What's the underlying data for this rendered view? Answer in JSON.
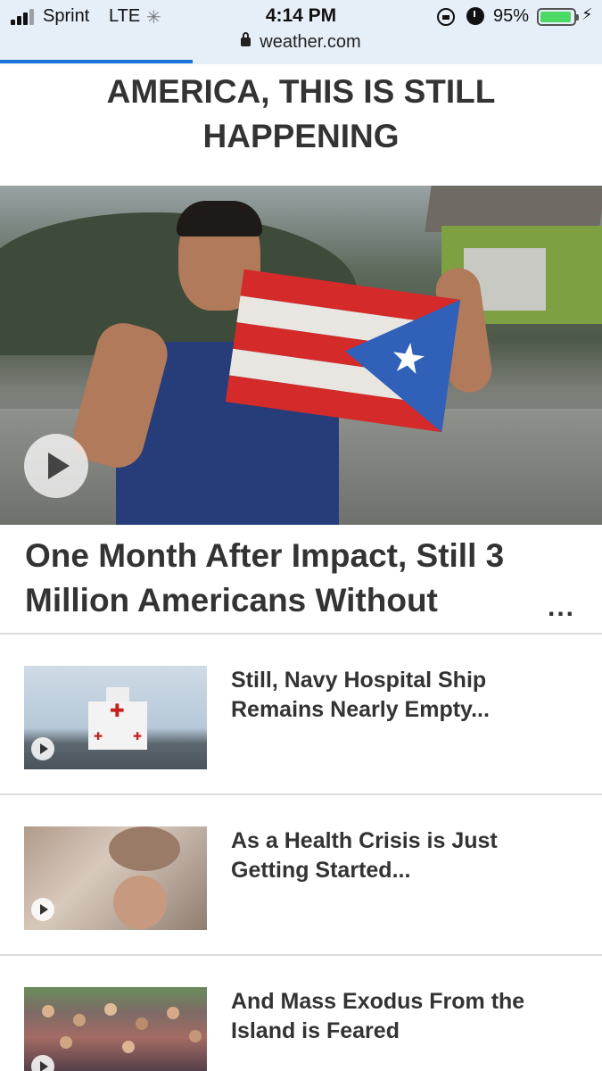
{
  "status_bar": {
    "carrier": "Sprint",
    "network": "LTE",
    "time": "4:14 PM",
    "battery_percent": "95%",
    "battery_level": 0.95
  },
  "browser": {
    "url": "weather.com",
    "load_progress": 0.32
  },
  "banner": {
    "headline": "AMERICA, THIS IS STILL HAPPENING"
  },
  "hero": {
    "image": "man-holding-damaged-puerto-rico-flag",
    "has_video": true
  },
  "main_article": {
    "title": "One Month After Impact, Still 3 Million Americans Without",
    "more": "..."
  },
  "articles": [
    {
      "title": "Still, Navy Hospital Ship Remains Nearly Empty...",
      "thumb": "hospital-ship",
      "has_video": true
    },
    {
      "title": "As a Health Crisis is Just Getting Started...",
      "thumb": "elderly-patient",
      "has_video": true
    },
    {
      "title": "And Mass Exodus From the Island is Feared",
      "thumb": "crowd",
      "has_video": true
    }
  ],
  "colors": {
    "accent": "#1a73d9",
    "battery": "#4cd964",
    "text": "#333333"
  }
}
